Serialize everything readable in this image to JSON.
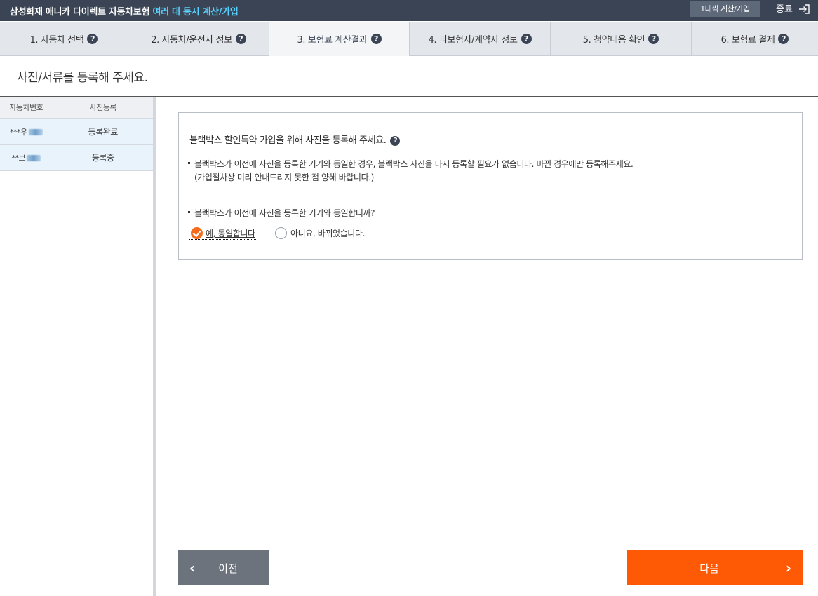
{
  "header": {
    "title_main": "삼성화재 애니카 다이렉트 자동차보험",
    "title_highlight": "여러 대 동시 계산/가입",
    "multi_button": "1대씩 계산/가입",
    "exit_button": "종료"
  },
  "steps": [
    {
      "label": "1. 자동차 선택",
      "help": "?"
    },
    {
      "label": "2. 자동차/운전자 정보",
      "help": "?"
    },
    {
      "label": "3. 보험료 계산결과",
      "help": "?"
    },
    {
      "label": "4. 피보험자/계약자 정보",
      "help": "?"
    },
    {
      "label": "5. 청약내용 확인",
      "help": "?"
    },
    {
      "label": "6. 보험료 결제",
      "help": "?"
    }
  ],
  "active_step": 3,
  "page_title": "사진/서류를 등록해 주세요.",
  "vehicle_table": {
    "headers": [
      "자동차번호",
      "사진등록"
    ],
    "rows": [
      {
        "plate": "***우",
        "status": "등록완료"
      },
      {
        "plate": "**보",
        "status": "등록중"
      }
    ]
  },
  "blackbox": {
    "title": "블랙박스 할인특약 가입을 위해 사진을 등록해 주세요.",
    "help": "?",
    "notice_line1": "블랙박스가 이전에 사진을 등록한 기기와 동일한 경우, 블랙박스 사진을 다시 등록할 필요가 없습니다. 바뀐 경우에만 등록해주세요.",
    "notice_line2": "(가입절차상 미리 안내드리지 못한 점 양해 바랍니다.)",
    "question": "블랙박스가 이전에 사진을 등록한 기기와 동일합니까?",
    "option_yes": "예, 동일합니다",
    "option_no": "아니요, 바뀌었습니다.",
    "selected": "yes"
  },
  "nav": {
    "prev_label": "이전",
    "prev_arrow": "‹",
    "next_label": "다음",
    "next_arrow": "›"
  },
  "colors": {
    "topbar": "#3a4454",
    "highlight": "#5ad2ff",
    "accent_orange": "#fe5a05",
    "prev_button": "#6d737c"
  }
}
